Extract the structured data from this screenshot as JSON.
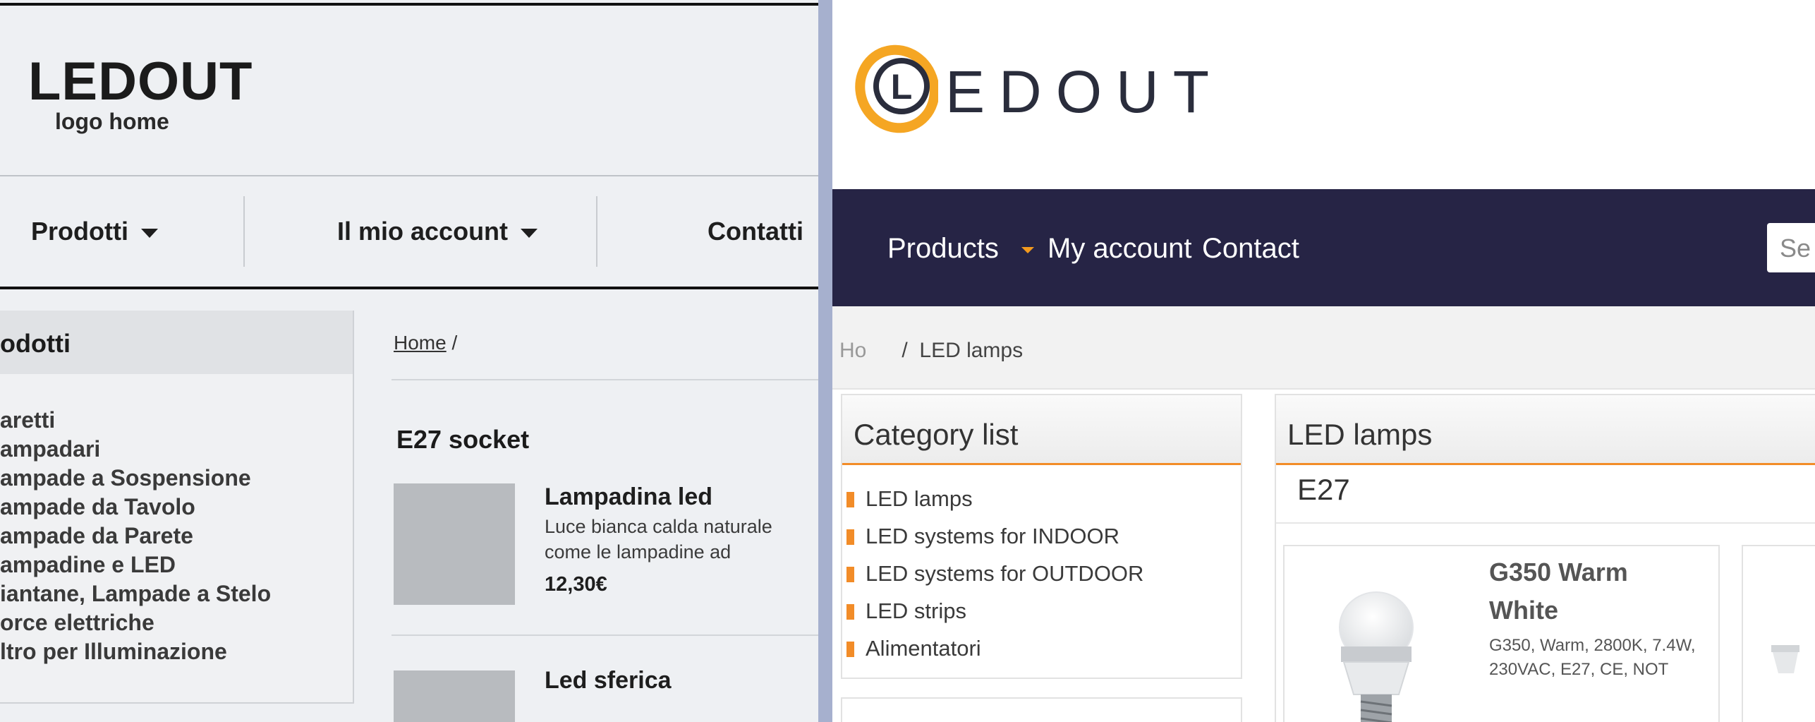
{
  "wireframe": {
    "logo": {
      "title": "LEDOUT",
      "subtitle": "logo home"
    },
    "nav": [
      {
        "label": "Prodotti"
      },
      {
        "label": "Il mio account"
      },
      {
        "label": "Contatti"
      }
    ],
    "sidebar": {
      "title": "odotti",
      "items": [
        "aretti",
        "ampadari",
        "ampade a Sospensione",
        "ampade da Tavolo",
        "ampade da Parete",
        "ampadine e LED",
        "iantane, Lampade a Stelo",
        "orce elettriche",
        "ltro per Illuminazione"
      ]
    },
    "breadcrumb": {
      "home": "Home",
      "separator": "/"
    },
    "section_title": "E27 socket",
    "products": [
      {
        "name": "Lampadina led",
        "description": "Luce bianca calda naturale come le lampadine ad",
        "price": "12,30€"
      },
      {
        "name": "Led sferica"
      }
    ]
  },
  "site": {
    "logo_letter": "L",
    "brand": "EDOUT",
    "nav": [
      {
        "label": "Products"
      },
      {
        "label": "My account"
      },
      {
        "label": "Contact"
      }
    ],
    "search_placeholder": "Se",
    "breadcrumb": {
      "home_fragment": "Ho",
      "separator": "/",
      "current": "LED lamps"
    },
    "category_panel": {
      "title": "Category list",
      "items": [
        "LED lamps",
        "LED systems for INDOOR",
        "LED systems for OUTDOOR",
        "LED strips",
        "Alimentatori"
      ]
    },
    "main_panel": {
      "title": "LED lamps",
      "subtitle": "E27",
      "product": {
        "name": "G350 Warm White",
        "description": "G350, Warm, 2800K, 7.4W, 230VAC, E27, CE, NOT"
      }
    }
  },
  "colors": {
    "wireframe_bg": "#eef0f3",
    "nav_dark": "#262445",
    "accent_orange": "#f28c28",
    "divider": "#a6b0ce"
  },
  "icons": [
    "chevron-down-icon",
    "arrow-right-icon",
    "ledout-logo-icon"
  ]
}
